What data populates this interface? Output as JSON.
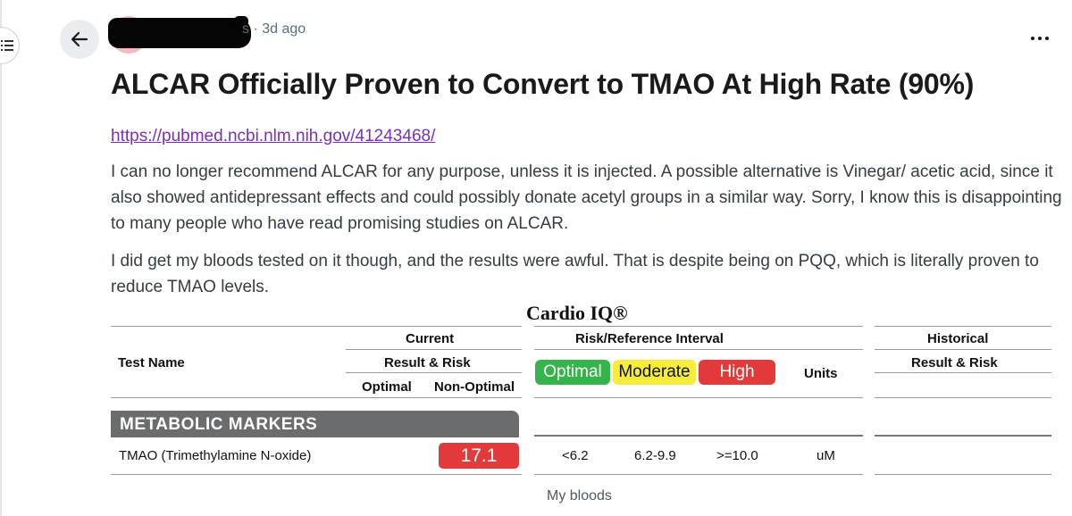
{
  "post": {
    "author_suffix": "s",
    "separator": "·",
    "age": "3d ago",
    "title": "ALCAR Officially Proven to Convert to TMAO At High Rate (90%)",
    "link": "https://pubmed.ncbi.nlm.nih.gov/41243468/",
    "paragraphs": [
      "I can no longer recommend ALCAR for any purpose, unless it is injected. A possible alternative is Vinegar/ acetic acid, since it also showed antidepressant effects and could possibly donate acetyl groups in a similar way. Sorry, I know this is disappointing to many people who have read promising studies on ALCAR.",
      "I did get my bloods tested on it though, and the results were awful. That is despite being on PQQ, which is literally proven to reduce TMAO levels."
    ],
    "image_caption": "My bloods"
  },
  "icons": {
    "menu": "menu-icon",
    "back": "arrow-left-icon",
    "more": "more-horizontal-icon"
  },
  "report": {
    "title": "Cardio IQ®",
    "headers": {
      "test_name": "Test Name",
      "current": "Current",
      "result_risk": "Result & Risk",
      "optimal": "Optimal",
      "non_optimal": "Non-Optimal",
      "risk_interval": "Risk/Reference Interval",
      "units": "Units",
      "historical": "Historical",
      "historical_result_risk": "Result & Risk"
    },
    "legend": {
      "optimal": "Optimal",
      "moderate": "Moderate",
      "high": "High"
    },
    "section": "METABOLIC MARKERS",
    "row": {
      "test": "TMAO (Trimethylamine N-oxide)",
      "value": "17.1",
      "optimal_range": "<6.2",
      "moderate_range": "6.2-9.9",
      "high_range": ">=10.0",
      "unit": "uM"
    },
    "colors": {
      "optimal": "#34b44a",
      "moderate": "#f5ec3c",
      "high": "#e23a3a",
      "section_bar": "#6b6c6d"
    }
  }
}
